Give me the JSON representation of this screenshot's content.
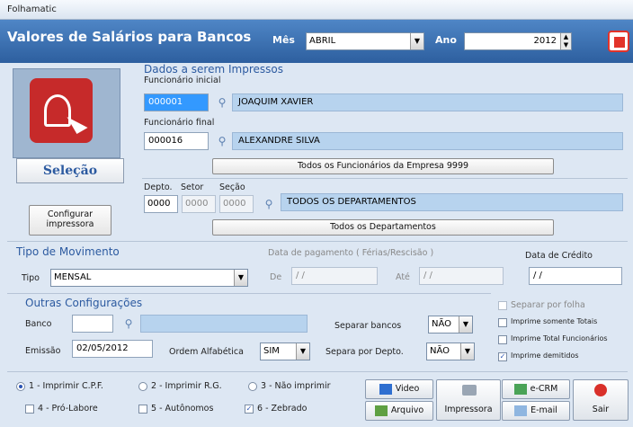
{
  "window": {
    "title": "Folhamatic"
  },
  "header": {
    "title": "Valores de Salários para Bancos",
    "mes_label": "Mês",
    "mes_value": "ABRIL",
    "ano_label": "Ano",
    "ano_value": "2012"
  },
  "selection": {
    "button": "Seleção",
    "configure": "Configurar impressora"
  },
  "dados": {
    "title": "Dados a serem Impressos",
    "func_ini_label": "Funcionário inicial",
    "func_ini_code": "000001",
    "func_ini_name": "JOAQUIM XAVIER",
    "func_fin_label": "Funcionário final",
    "func_fin_code": "000016",
    "func_fin_name": "ALEXANDRE  SILVA",
    "all_func_button": "Todos os Funcionários da Empresa 9999",
    "depto_label": "Depto.",
    "setor_label": "Setor",
    "secao_label": "Seção",
    "depto": "0000",
    "setor": "0000",
    "secao": "0000",
    "depto_name": "TODOS OS DEPARTAMENTOS",
    "all_depto_button": "Todos os Departamentos"
  },
  "movimento": {
    "title": "Tipo de Movimento",
    "tipo_label": "Tipo",
    "tipo_value": "MENSAL",
    "data_pag_label": "Data de pagamento ( Férias/Rescisão )",
    "de_label": "De",
    "de_value": "/ /",
    "ate_label": "Até",
    "ate_value": "/ /",
    "credito_label": "Data de Crédito",
    "credito_value": "/ /"
  },
  "outras": {
    "title": "Outras Configurações",
    "banco_label": "Banco",
    "banco_value": "",
    "emissao_label": "Emissão",
    "emissao_value": "02/05/2012",
    "ordem_label": "Ordem Alfabética",
    "ordem_value": "SIM",
    "separar_bancos_label": "Separar bancos",
    "separar_bancos_value": "NÃO",
    "separa_depto_label": "Separa por Depto.",
    "separa_depto_value": "NÃO"
  },
  "checks": {
    "separar_folha": "Separar por folha",
    "somente_totais": "Imprime somente Totais",
    "total_func": "Imprime Total Funcionários",
    "demitidos": "Imprime demitidos"
  },
  "options": {
    "cpf": "1 - Imprimir C.P.F.",
    "rg": "2 - Imprimir R.G.",
    "nao": "3 - Não imprimir",
    "pro_labore": "4 - Pró-Labore",
    "autonomos": "5 - Autônomos",
    "zebrado": "6 - Zebrado"
  },
  "buttons": {
    "video": "Video",
    "arquivo": "Arquivo",
    "impressora": "Impressora",
    "ecrm": "e-CRM",
    "email": "E-mail",
    "sair": "Sair"
  }
}
